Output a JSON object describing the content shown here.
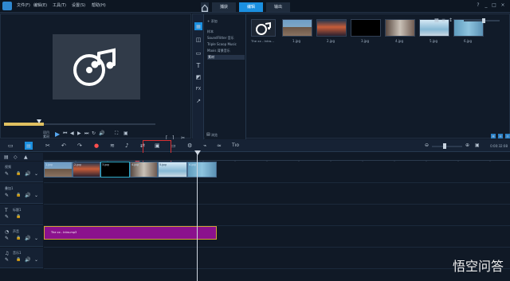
{
  "titlebar": {
    "menus": [
      "文件(F)",
      "编辑(E)",
      "工具(T)",
      "设置(S)",
      "帮助(H)"
    ],
    "tabs": [
      "捕获",
      "编辑",
      "输出"
    ],
    "active_tab": "编辑",
    "window_controls": [
      "?",
      "_",
      "□",
      "×"
    ]
  },
  "preview": {
    "timecode": "00:00:00:00",
    "left_labels": [
      "项目",
      "素材"
    ],
    "icons": [
      "music-icon",
      "play-icon"
    ]
  },
  "library": {
    "add_label": "+ 添加",
    "folders": [
      "样本",
      "SoundFlitter 音乐",
      "Triple Scoop Music",
      "Maxis 背景音乐",
      "素材"
    ],
    "browse_label": "浏览",
    "items": [
      {
        "label": "The xx - Intro...",
        "type": "music"
      },
      {
        "label": "1.jpg",
        "type": "photo"
      },
      {
        "label": "2.jpg",
        "type": "photo"
      },
      {
        "label": "3.jpg",
        "type": "photo"
      },
      {
        "label": "4.jpg",
        "type": "photo"
      },
      {
        "label": "5.jpg",
        "type": "photo"
      },
      {
        "label": "6.jpg",
        "type": "photo"
      }
    ]
  },
  "timeline": {
    "timecode": "0:00:32:08",
    "tracks": [
      {
        "name": "视频",
        "clips": [
          "1.jpg",
          "2.jpg",
          "3.jpg",
          "4.jpg",
          "5.jpg",
          "6.jpg"
        ]
      },
      {
        "name": "叠加1",
        "clips": []
      },
      {
        "name": "标题1",
        "clips": []
      },
      {
        "name": "声音",
        "clips": [
          "The xx - Intro.mp3"
        ]
      },
      {
        "name": "音乐1",
        "clips": []
      }
    ]
  },
  "watermark": "悟空问答",
  "colors": {
    "accent": "#1a8fe0",
    "audio_clip": "#8b118d",
    "highlight_box": "#d72f32",
    "playhead": "#cfd7e1"
  }
}
